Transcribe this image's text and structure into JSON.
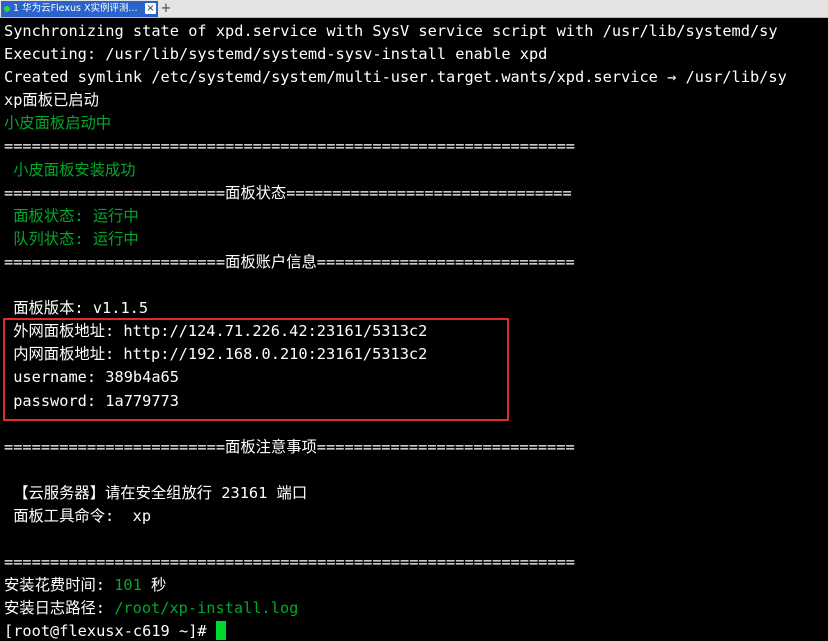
{
  "tabbar": {
    "tab_title": "1 华为云Flexus X实例评测...",
    "close_glyph": "×",
    "add_glyph": "+"
  },
  "terminal": {
    "lines": [
      {
        "text": "Synchronizing state of xpd.service with SysV service script with /usr/lib/systemd/sy",
        "color": "#ffffff"
      },
      {
        "text": "Executing: /usr/lib/systemd/systemd-sysv-install enable xpd",
        "color": "#ffffff"
      },
      {
        "text": "Created symlink /etc/systemd/system/multi-user.target.wants/xpd.service → /usr/lib/sy",
        "color": "#ffffff"
      },
      {
        "text": "xp面板已启动",
        "color": "#ffffff"
      },
      {
        "text": "小皮面板启动中",
        "color": "#00a82a"
      },
      {
        "text": "==============================================================",
        "color": "#ffffff"
      },
      {
        "text": " 小皮面板安装成功",
        "color": "#00a82a"
      },
      {
        "text": "========================面板状态===============================",
        "color": "#ffffff"
      },
      {
        "text": " 面板状态: 运行中",
        "color": "#00a82a"
      },
      {
        "text": " 队列状态: 运行中",
        "color": "#00a82a"
      },
      {
        "text": "========================面板账户信息============================",
        "color": "#ffffff"
      },
      {
        "text": "",
        "color": "#ffffff"
      },
      {
        "text": " 面板版本: v1.1.5",
        "color": "#ffffff"
      },
      {
        "text": " 外网面板地址: http://124.71.226.42:23161/5313c2",
        "color": "#ffffff"
      },
      {
        "text": " 内网面板地址: http://192.168.0.210:23161/5313c2",
        "color": "#ffffff"
      },
      {
        "text": " username: 389b4a65",
        "color": "#ffffff"
      },
      {
        "text": " password: 1a779773",
        "color": "#ffffff"
      },
      {
        "text": "",
        "color": "#ffffff"
      },
      {
        "text": "========================面板注意事项============================",
        "color": "#ffffff"
      },
      {
        "text": "",
        "color": "#ffffff"
      },
      {
        "text": " 【云服务器】请在安全组放行 23161 端口",
        "color": "#ffffff"
      },
      {
        "text": " 面板工具命令:  xp",
        "color": "#ffffff"
      },
      {
        "text": "",
        "color": "#ffffff"
      },
      {
        "text": "==============================================================",
        "color": "#ffffff"
      }
    ],
    "install_time_label": "安装花费时间: ",
    "install_time_value": "101",
    "install_time_unit": " 秒",
    "install_log_label": "安装日志路径: ",
    "install_log_value": "/root/xp-install.log",
    "prompt": "[root@flexusx-c619 ~]# "
  },
  "colors": {
    "terminal_bg": "#000000",
    "text_white": "#ffffff",
    "text_green": "#00a82a",
    "highlight_red": "#e22828",
    "cursor_green": "#00d62b",
    "tab_blue": "#2a63c9"
  }
}
